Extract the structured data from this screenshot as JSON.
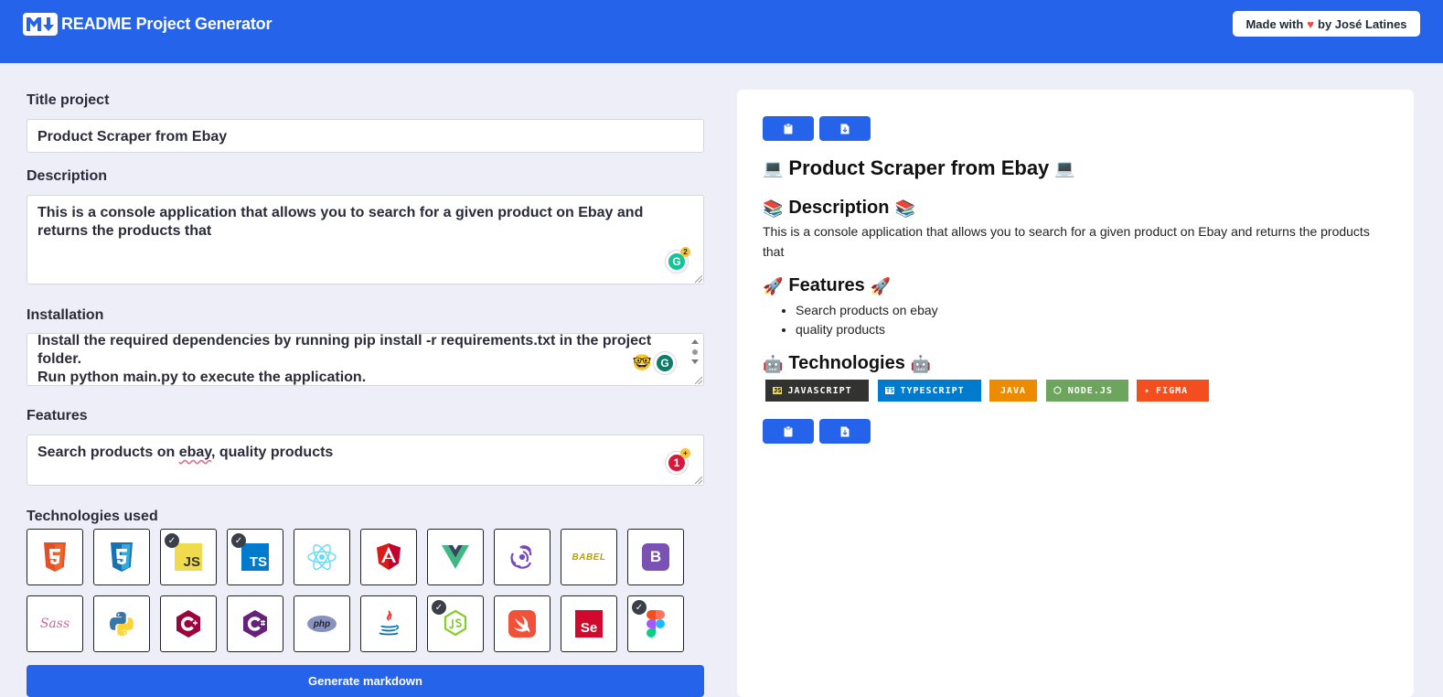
{
  "header": {
    "logo": "markdown-logo",
    "title": "README Project Generator",
    "made_with_prefix": "Made with",
    "made_with_suffix": "by José Latines",
    "brand_color": "#2563eb"
  },
  "form": {
    "title_label": "Title project",
    "title_value": "Product Scraper from Ebay",
    "description_label": "Description",
    "description_value": "This is a console application that allows you to search for a given product on Ebay and returns the products that",
    "installation_label": "Installation",
    "installation_lines": [
      "Install the required dependencies by running pip install -r requirements.txt in the project",
      "folder.",
      "Run python main.py to execute the application."
    ],
    "features_label": "Features",
    "features_value_before": "Search products on ",
    "features_value_misspelled": "ebay",
    "features_value_after": ", quality products",
    "grammarly_description_count": "2",
    "grammarly_features_count": "1",
    "technologies_label": "Technologies used",
    "technologies": [
      {
        "name": "html5",
        "selected": false
      },
      {
        "name": "css3",
        "selected": false
      },
      {
        "name": "javascript",
        "selected": true
      },
      {
        "name": "typescript",
        "selected": true
      },
      {
        "name": "react",
        "selected": false
      },
      {
        "name": "angular",
        "selected": false
      },
      {
        "name": "vue",
        "selected": false
      },
      {
        "name": "redux",
        "selected": false
      },
      {
        "name": "babel",
        "selected": false
      },
      {
        "name": "bootstrap",
        "selected": false
      },
      {
        "name": "sass",
        "selected": false
      },
      {
        "name": "python",
        "selected": false
      },
      {
        "name": "cplusplus",
        "selected": false
      },
      {
        "name": "csharp",
        "selected": false
      },
      {
        "name": "php",
        "selected": false
      },
      {
        "name": "java",
        "selected": false
      },
      {
        "name": "nodejs",
        "selected": true
      },
      {
        "name": "swift",
        "selected": false
      },
      {
        "name": "selenium",
        "selected": false
      },
      {
        "name": "figma",
        "selected": true
      }
    ],
    "tech_icon_text": {
      "javascript": "JS",
      "typescript": "TS",
      "babel": "BABEL",
      "bootstrap": "B",
      "sass": "Sass",
      "php": "php",
      "selenium": "Se"
    },
    "generate_label": "Generate markdown"
  },
  "preview": {
    "title": "Product Scraper from Ebay",
    "description_heading": "Description",
    "description_text": "This is a console application that allows you to search for a given product on Ebay and returns the products that",
    "features_heading": "Features",
    "features": [
      "Search products on ebay",
      "quality products"
    ],
    "technologies_heading": "Technologies",
    "shields": [
      {
        "label": "JAVASCRIPT",
        "color": "#323330",
        "icon": "JS"
      },
      {
        "label": "TYPESCRIPT",
        "color": "#007acc",
        "icon": "TS"
      },
      {
        "label": "JAVA",
        "color": "#ed8b00",
        "icon": ""
      },
      {
        "label": "NODE.JS",
        "color": "#6da55f",
        "icon": "⬡"
      },
      {
        "label": "FIGMA",
        "color": "#f24e1e",
        "icon": "✦"
      }
    ],
    "copy_icon": "clipboard-icon",
    "download_icon": "download-icon"
  }
}
